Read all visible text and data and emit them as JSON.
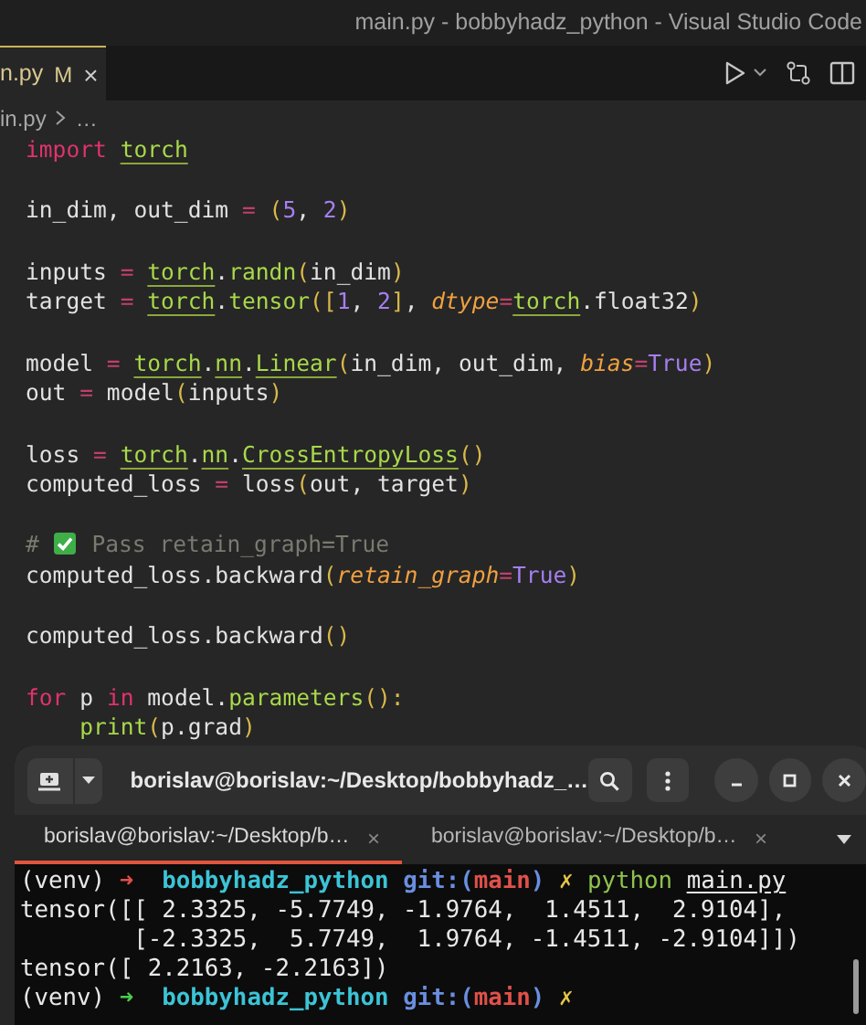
{
  "window": {
    "title": "main.py - bobbyhadz_python - Visual Studio Code"
  },
  "editor_tab": {
    "label": "n.py",
    "badge": "M",
    "close": "×",
    "selected": true
  },
  "breadcrumb": [
    "in.py",
    "…"
  ],
  "code_lines": [
    {
      "kind": "code",
      "tokens": [
        {
          "text": "import ",
          "kind": "keyword"
        },
        {
          "text": "torch",
          "kind": "module"
        }
      ]
    },
    {
      "kind": "blank"
    },
    {
      "kind": "code",
      "tokens": [
        {
          "text": "in_dim, out_dim ",
          "kind": "plain"
        },
        {
          "text": "= ",
          "kind": "op"
        },
        {
          "text": "(",
          "kind": "punct"
        },
        {
          "text": "5",
          "kind": "number"
        },
        {
          "text": ", ",
          "kind": "plain"
        },
        {
          "text": "2",
          "kind": "number"
        },
        {
          "text": ")",
          "kind": "punct"
        }
      ]
    },
    {
      "kind": "blank"
    },
    {
      "kind": "code",
      "tokens": [
        {
          "text": "inputs ",
          "kind": "plain"
        },
        {
          "text": "= ",
          "kind": "op"
        },
        {
          "text": "torch",
          "kind": "module"
        },
        {
          "text": ".",
          "kind": "plain"
        },
        {
          "text": "randn",
          "kind": "func"
        },
        {
          "text": "(",
          "kind": "punct"
        },
        {
          "text": "in_dim",
          "kind": "plain"
        },
        {
          "text": ")",
          "kind": "punct"
        }
      ]
    },
    {
      "kind": "code",
      "tokens": [
        {
          "text": "target ",
          "kind": "plain"
        },
        {
          "text": "= ",
          "kind": "op"
        },
        {
          "text": "torch",
          "kind": "module"
        },
        {
          "text": ".",
          "kind": "plain"
        },
        {
          "text": "tensor",
          "kind": "func"
        },
        {
          "text": "(",
          "kind": "punct"
        },
        {
          "text": "[",
          "kind": "punct"
        },
        {
          "text": "1",
          "kind": "number"
        },
        {
          "text": ", ",
          "kind": "plain"
        },
        {
          "text": "2",
          "kind": "number"
        },
        {
          "text": "]",
          "kind": "punct"
        },
        {
          "text": ", ",
          "kind": "plain"
        },
        {
          "text": "dtype",
          "kind": "param"
        },
        {
          "text": "=",
          "kind": "op"
        },
        {
          "text": "torch",
          "kind": "module"
        },
        {
          "text": ".float32",
          "kind": "plain"
        },
        {
          "text": ")",
          "kind": "punct"
        }
      ]
    },
    {
      "kind": "blank"
    },
    {
      "kind": "code",
      "tokens": [
        {
          "text": "model ",
          "kind": "plain"
        },
        {
          "text": "= ",
          "kind": "op"
        },
        {
          "text": "torch",
          "kind": "module"
        },
        {
          "text": ".",
          "kind": "plain"
        },
        {
          "text": "nn",
          "kind": "module"
        },
        {
          "text": ".",
          "kind": "plain"
        },
        {
          "text": "Linear",
          "kind": "module"
        },
        {
          "text": "(",
          "kind": "punct"
        },
        {
          "text": "in_dim, out_dim, ",
          "kind": "plain"
        },
        {
          "text": "bias",
          "kind": "param"
        },
        {
          "text": "=",
          "kind": "op"
        },
        {
          "text": "True",
          "kind": "number"
        },
        {
          "text": ")",
          "kind": "punct"
        }
      ]
    },
    {
      "kind": "code",
      "tokens": [
        {
          "text": "out ",
          "kind": "plain"
        },
        {
          "text": "=",
          "kind": "op"
        },
        {
          "text": " model",
          "kind": "plain"
        },
        {
          "text": "(",
          "kind": "punct"
        },
        {
          "text": "inputs",
          "kind": "plain"
        },
        {
          "text": ")",
          "kind": "punct"
        }
      ]
    },
    {
      "kind": "blank"
    },
    {
      "kind": "code",
      "tokens": [
        {
          "text": "loss ",
          "kind": "plain"
        },
        {
          "text": "= ",
          "kind": "op"
        },
        {
          "text": "torch",
          "kind": "module"
        },
        {
          "text": ".",
          "kind": "plain"
        },
        {
          "text": "nn",
          "kind": "module"
        },
        {
          "text": ".",
          "kind": "plain"
        },
        {
          "text": "CrossEntropyLoss",
          "kind": "module"
        },
        {
          "text": "()",
          "kind": "punct"
        }
      ]
    },
    {
      "kind": "code",
      "tokens": [
        {
          "text": "computed_loss ",
          "kind": "plain"
        },
        {
          "text": "=",
          "kind": "op"
        },
        {
          "text": " loss",
          "kind": "plain"
        },
        {
          "text": "(",
          "kind": "punct"
        },
        {
          "text": "out, target",
          "kind": "plain"
        },
        {
          "text": ")",
          "kind": "punct"
        }
      ]
    },
    {
      "kind": "blank"
    },
    {
      "kind": "code",
      "tokens": [
        {
          "text": "# ",
          "kind": "comment"
        },
        {
          "kind": "check"
        },
        {
          "text": " Pass retain_graph=True",
          "kind": "comment"
        }
      ]
    },
    {
      "kind": "code",
      "tokens": [
        {
          "text": "computed_loss.backward",
          "kind": "plain"
        },
        {
          "text": "(",
          "kind": "punct"
        },
        {
          "text": "retain_graph",
          "kind": "param"
        },
        {
          "text": "=",
          "kind": "op"
        },
        {
          "text": "True",
          "kind": "number"
        },
        {
          "text": ")",
          "kind": "punct"
        }
      ]
    },
    {
      "kind": "blank"
    },
    {
      "kind": "code",
      "tokens": [
        {
          "text": "computed_loss.backward",
          "kind": "plain"
        },
        {
          "text": "()",
          "kind": "punct"
        }
      ]
    },
    {
      "kind": "blank"
    },
    {
      "kind": "code",
      "tokens": [
        {
          "text": "for",
          "kind": "keyword"
        },
        {
          "text": " p ",
          "kind": "plain"
        },
        {
          "text": "in",
          "kind": "keyword"
        },
        {
          "text": " model.",
          "kind": "plain"
        },
        {
          "text": "parameters",
          "kind": "func"
        },
        {
          "text": "():",
          "kind": "punct"
        }
      ]
    },
    {
      "kind": "code",
      "tokens": [
        {
          "text": "    print",
          "kind": "func"
        },
        {
          "text": "(",
          "kind": "punct"
        },
        {
          "text": "p.grad",
          "kind": "plain"
        },
        {
          "text": ")",
          "kind": "punct"
        }
      ]
    }
  ],
  "terminal": {
    "title": "borislav@borislav:~/Desktop/bobbyhadz_…",
    "tabs": [
      {
        "label": "borislav@borislav:~/Desktop/b…",
        "close": "×",
        "selected": true
      },
      {
        "label": "borislav@borislav:~/Desktop/b…",
        "close": "×",
        "selected": false
      }
    ],
    "lines": [
      {
        "tokens": [
          {
            "text": "(venv) ",
            "kind": "plain"
          },
          {
            "text": "➜  ",
            "kind": "arrow-error"
          },
          {
            "text": "bobbyhadz_python ",
            "kind": "dir"
          },
          {
            "text": "git:(",
            "kind": "git"
          },
          {
            "text": "main",
            "kind": "branch"
          },
          {
            "text": ") ",
            "kind": "git"
          },
          {
            "text": "✗ ",
            "kind": "dirty"
          },
          {
            "text": "python ",
            "kind": "command"
          },
          {
            "text": "main.py",
            "kind": "path"
          }
        ]
      },
      {
        "tokens": [
          {
            "text": "tensor([[ 2.3325, -5.7749, -1.9764,  1.4511,  2.9104],",
            "kind": "plain"
          }
        ]
      },
      {
        "tokens": [
          {
            "text": "        [-2.3325,  5.7749,  1.9764, -1.4511, -2.9104]])",
            "kind": "plain"
          }
        ]
      },
      {
        "tokens": [
          {
            "text": "tensor([ 2.2163, -2.2163])",
            "kind": "plain"
          }
        ]
      },
      {
        "tokens": [
          {
            "text": "(venv) ",
            "kind": "plain"
          },
          {
            "text": "➜  ",
            "kind": "arrow-ok"
          },
          {
            "text": "bobbyhadz_python ",
            "kind": "dir"
          },
          {
            "text": "git:(",
            "kind": "git"
          },
          {
            "text": "main",
            "kind": "branch"
          },
          {
            "text": ") ",
            "kind": "git"
          },
          {
            "text": "✗",
            "kind": "dirty"
          }
        ]
      }
    ]
  }
}
